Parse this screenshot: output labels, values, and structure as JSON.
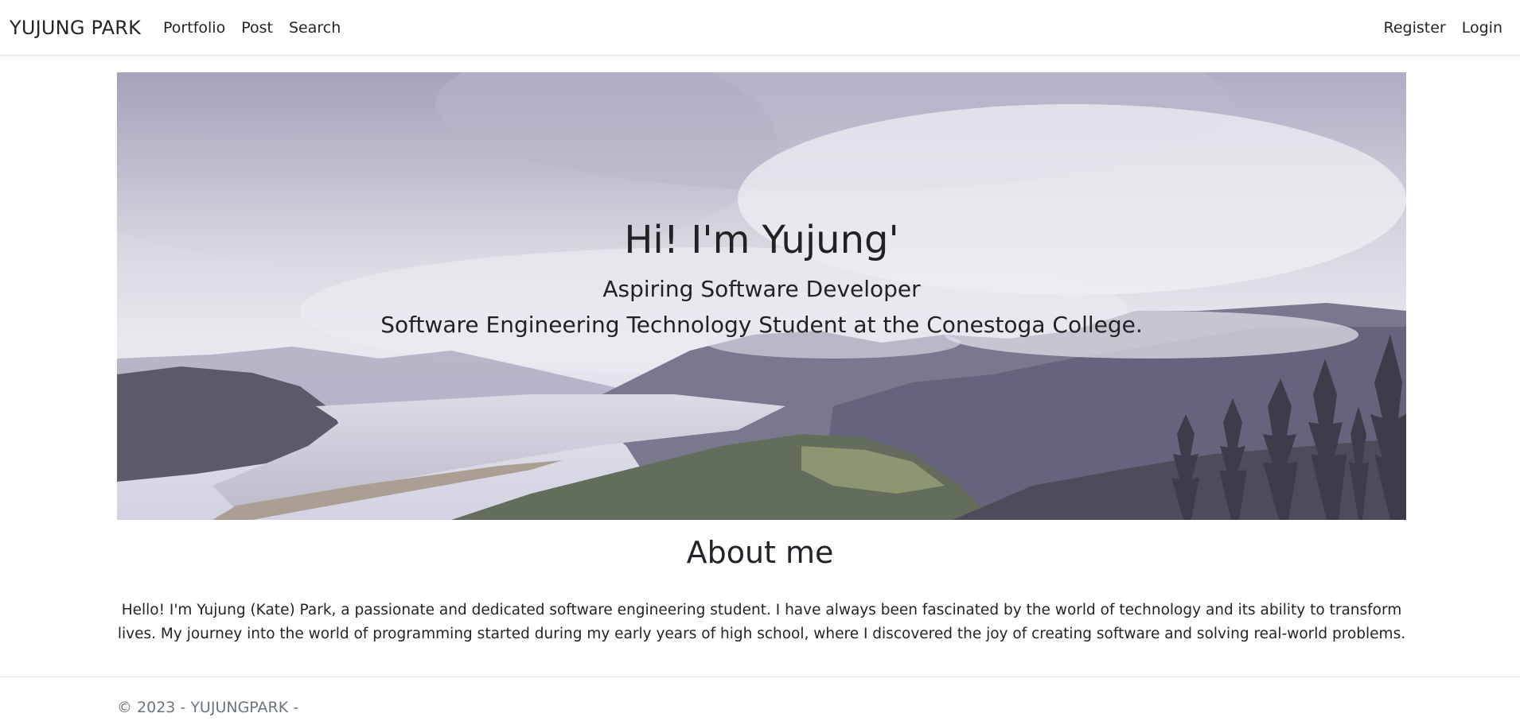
{
  "navbar": {
    "brand": "YUJUNG PARK",
    "left_links": [
      "Portfolio",
      "Post",
      "Search"
    ],
    "right_links": [
      "Register",
      "Login"
    ]
  },
  "hero": {
    "title": "Hi! I'm Yujung'",
    "subtitle_1": "Aspiring Software Developer",
    "subtitle_2": "Software Engineering Technology Student at the Conestoga College."
  },
  "about": {
    "heading": "About me",
    "body": "Hello! I'm Yujung (Kate) Park, a passionate and dedicated software engineering student. I have always been fascinated by the world of technology and its ability to transform lives. My journey into the world of programming started during my early years of high school, where I discovered the joy of creating software and solving real-world problems."
  },
  "footer": {
    "text": "© 2023 - YUJUNGPARK -"
  }
}
